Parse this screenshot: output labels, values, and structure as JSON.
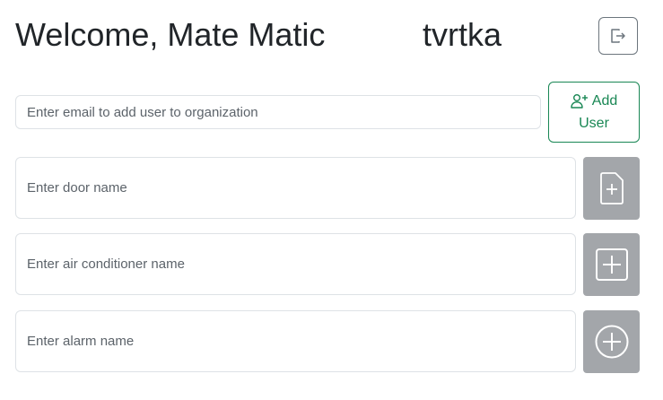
{
  "header": {
    "welcome_text": "Welcome, Mate Matic",
    "organization_name": "tvrtka",
    "logout_icon": "box-arrow-right-icon"
  },
  "add_user": {
    "email_placeholder": "Enter email to add user to organization",
    "email_value": "",
    "button_line1": "Add",
    "button_line2": "User",
    "button_icon": "person-plus-icon",
    "accent_color": "#198754"
  },
  "devices": [
    {
      "placeholder": "Enter door name",
      "value": "",
      "icon": "file-plus-icon"
    },
    {
      "placeholder": "Enter air conditioner name",
      "value": "",
      "icon": "plus-square-icon"
    },
    {
      "placeholder": "Enter alarm name",
      "value": "",
      "icon": "plus-circle-icon"
    }
  ],
  "colors": {
    "device_button_bg": "#a3a6aa",
    "text": "#212529",
    "border": "#dee2e6"
  }
}
